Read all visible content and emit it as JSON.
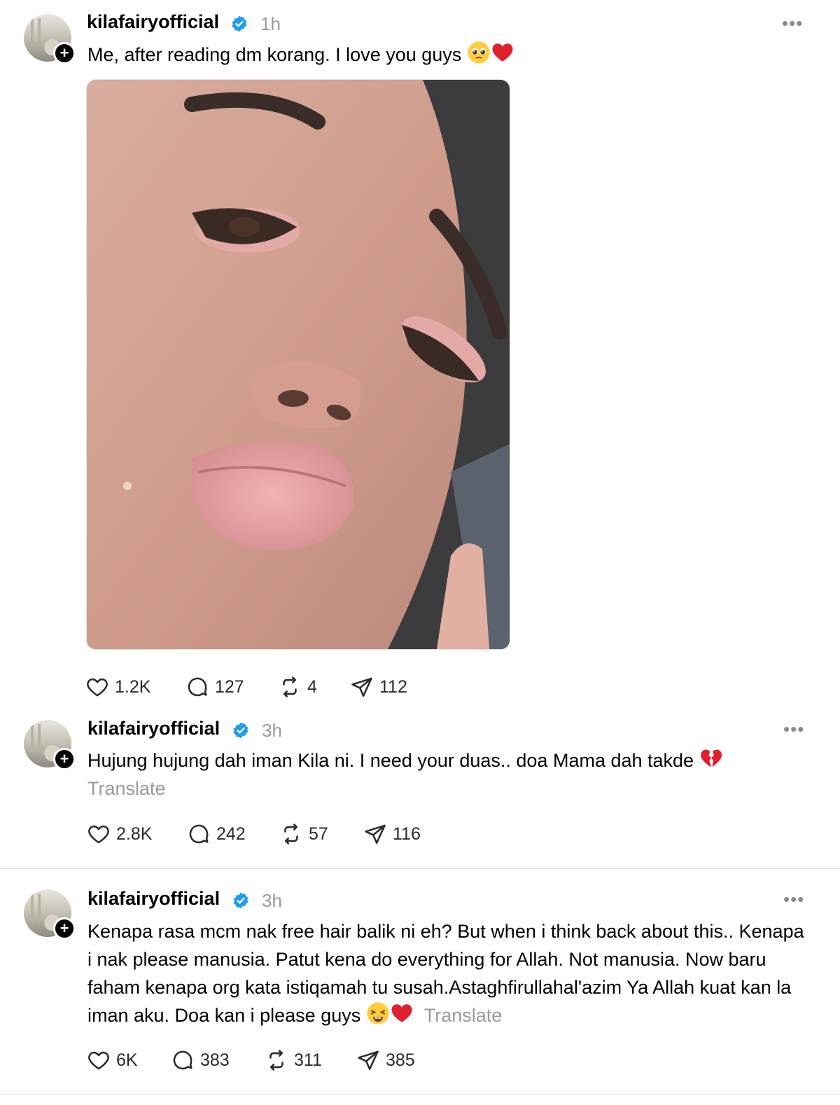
{
  "posts": [
    {
      "username": "kilafairyofficial",
      "time": "1h",
      "text": "Me, after reading dm korang. I love you guys",
      "emojis": [
        "pleading-face",
        "red-heart"
      ],
      "has_image": true,
      "image_description_icon": "photo",
      "likes": "1.2K",
      "replies": "127",
      "reposts": "4",
      "shares": "112"
    },
    {
      "username": "kilafairyofficial",
      "time": "3h",
      "text": "Hujung hujung dah iman Kila ni. I need your duas.. doa Mama dah takde",
      "emojis": [
        "broken-heart"
      ],
      "translate": "Translate",
      "likes": "2.8K",
      "replies": "242",
      "reposts": "57",
      "shares": "116"
    },
    {
      "username": "kilafairyofficial",
      "time": "3h",
      "text": "Kenapa rasa mcm nak free hair balik ni eh? But when i think back about this.. Kenapa i nak please manusia. Patut kena do everything for Allah. Not manusia. Now baru faham kenapa org kata istiqamah tu susah.Astaghfirullahal'azim Ya Allah kuat kan la iman aku. Doa kan i please guys",
      "emojis": [
        "weary-face",
        "red-heart"
      ],
      "translate": "Translate",
      "likes": "6K",
      "replies": "383",
      "reposts": "311",
      "shares": "385"
    }
  ],
  "colors": {
    "verified": "#1d9bf0",
    "muted": "#9a9a9a",
    "text": "#000000",
    "heart": "#e0202e"
  },
  "icons": {
    "like": "heart-outline-icon",
    "reply": "speech-bubble-icon",
    "repost": "repost-arrows-icon",
    "share": "paper-plane-icon",
    "more": "more-dots-icon"
  }
}
